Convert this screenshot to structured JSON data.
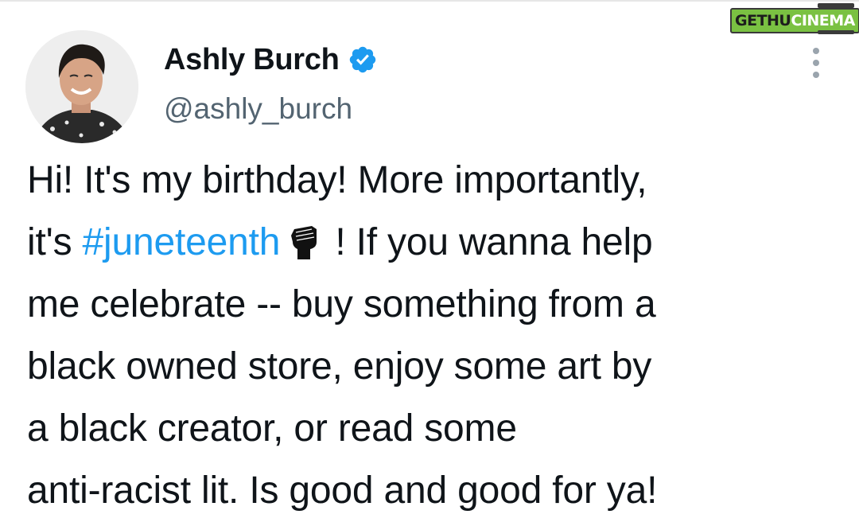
{
  "watermark": {
    "part1": "GETHU",
    "part2": "CINEMA"
  },
  "author": {
    "name": "Ashly Burch",
    "handle": "@ashly_burch",
    "verified_icon": "verified-badge-icon",
    "avatar": "profile photo"
  },
  "tweet": {
    "line1": "Hi! It's my birthday! More importantly,",
    "line2_pre": "it's ",
    "hashtag": "#juneteenth",
    "emoji_icon": "raised-fist-icon",
    "line2_post": " ! If you wanna help",
    "line3": "me celebrate -- buy something from a",
    "line4": "black owned store, enjoy some art by",
    "line5": "a black creator, or read some",
    "line6": "anti-racist lit. Is good and good for ya!"
  },
  "colors": {
    "hashtag": "#1d9bf0",
    "verified": "#1d9bf0",
    "text": "#0f1419",
    "secondary": "#536471"
  }
}
